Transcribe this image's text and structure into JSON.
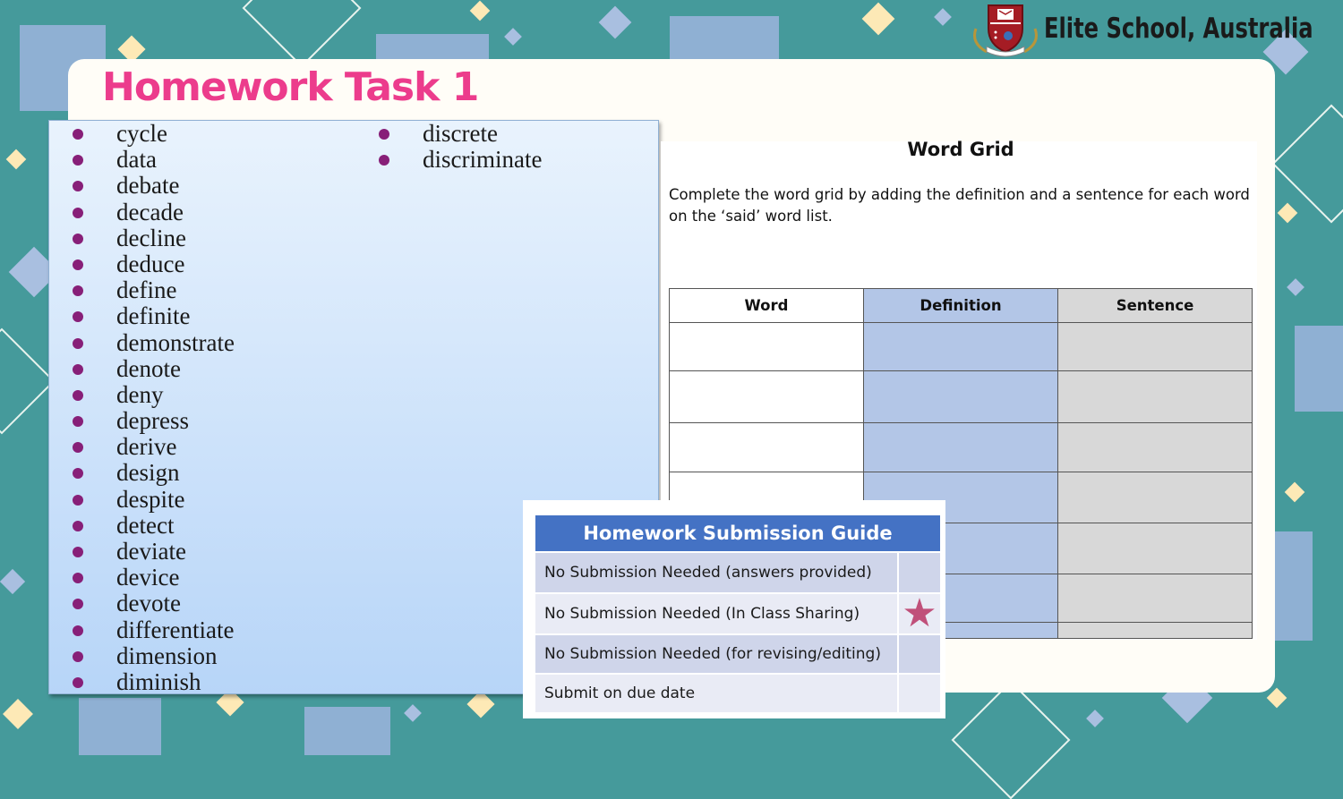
{
  "header": {
    "title": "Homework Task 1",
    "school": "Elite School, Australia",
    "logo_icon": "school-crest-icon"
  },
  "word_list": {
    "column1": [
      "cycle",
      "data",
      "debate",
      "decade",
      "decline",
      "deduce",
      "define",
      "definite",
      "demonstrate",
      "denote",
      "deny",
      "depress",
      "derive",
      "design",
      "despite",
      "detect",
      "deviate",
      "device",
      "devote",
      "differentiate",
      "dimension",
      "diminish"
    ],
    "column2": [
      "discrete",
      "discriminate"
    ]
  },
  "word_grid": {
    "title": "Word Grid",
    "instructions": "Complete the word grid by adding the definition and a sentence for each word on the ‘said’ word list.",
    "headers": [
      "Word",
      "Definition",
      "Sentence"
    ],
    "row_count": 7
  },
  "submission_guide": {
    "title": "Homework Submission Guide",
    "options": [
      {
        "label": "No Submission Needed (answers provided)",
        "marked": false
      },
      {
        "label": "No Submission Needed (In Class Sharing)",
        "marked": true
      },
      {
        "label": "No Submission Needed (for revising/editing)",
        "marked": false
      },
      {
        "label": "Submit on due date",
        "marked": false
      }
    ],
    "mark_icon": "star-icon"
  },
  "colors": {
    "title_pink": "#ec3c8c",
    "bullet_purple": "#871f78",
    "guide_header_blue": "#4472c4",
    "background_teal": "#459a9b"
  }
}
